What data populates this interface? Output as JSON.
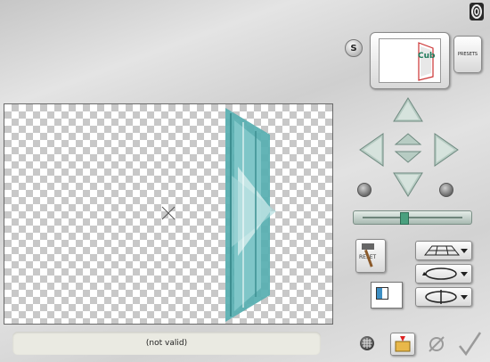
{
  "header": {
    "s_label": "S",
    "presets_label": "PRESETS"
  },
  "preview": {
    "title": "Cub"
  },
  "toolbar": {
    "reset_label": "RESET"
  },
  "status": {
    "text": "(not valid)"
  },
  "slider": {
    "value": 0.5
  },
  "colors": {
    "accent": "#4fa8a8",
    "arrow": "#a9c2b8",
    "knob": "#49a07e"
  }
}
